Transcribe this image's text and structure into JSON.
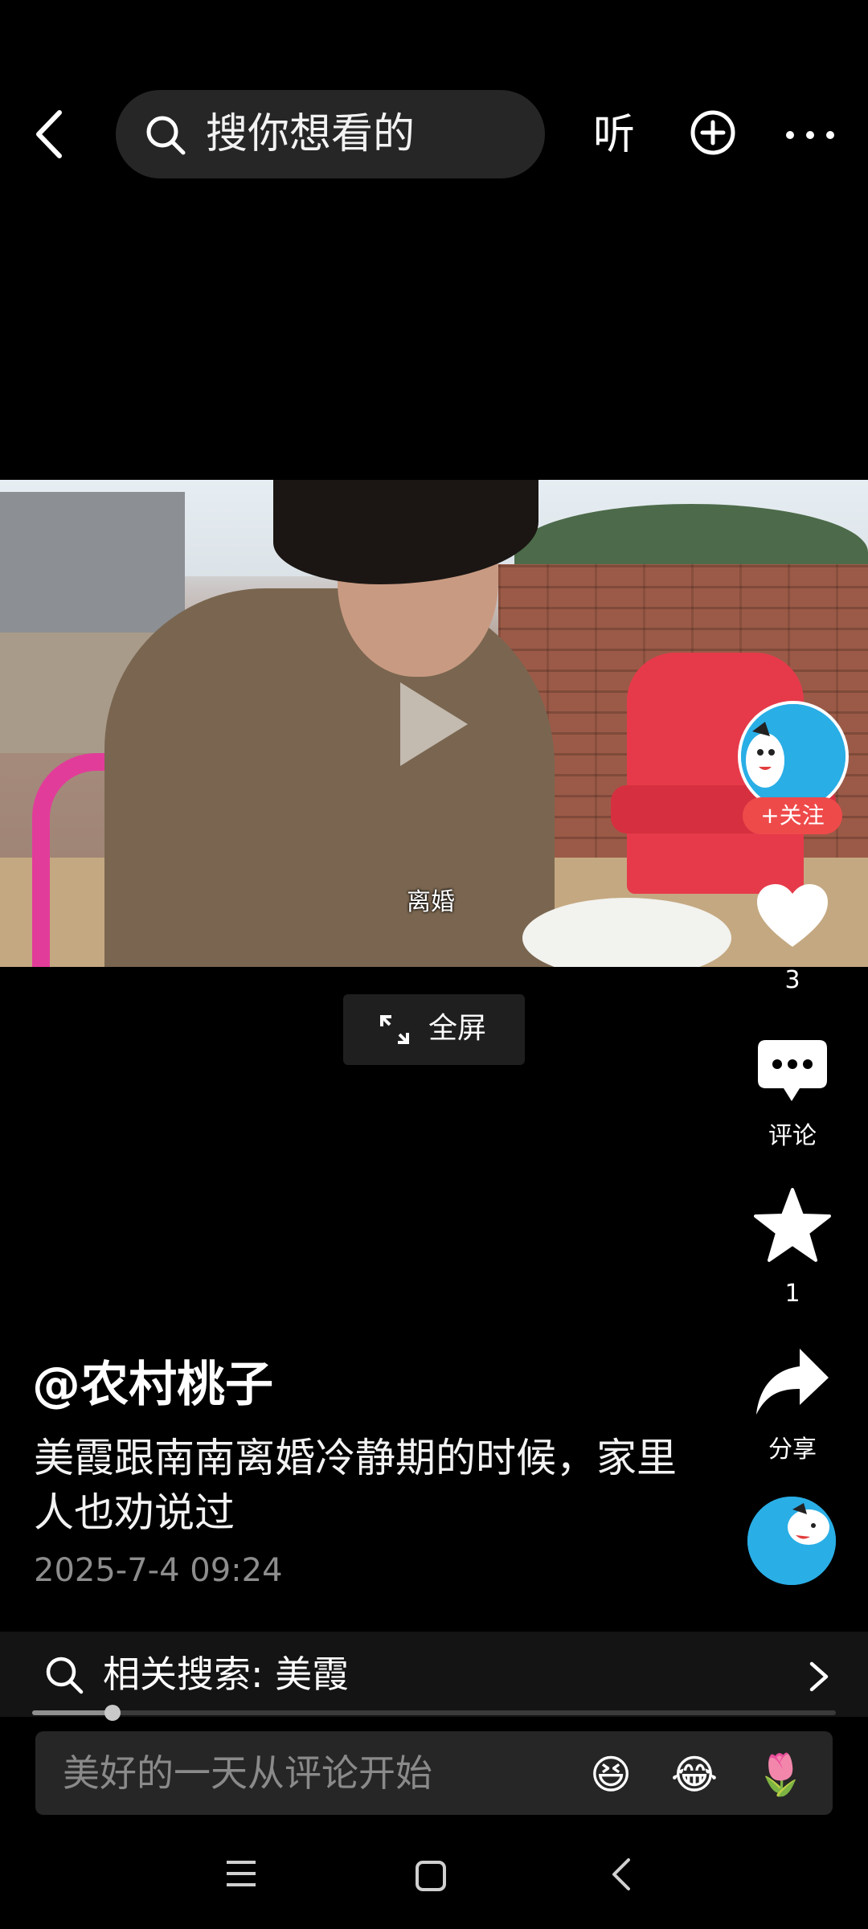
{
  "top_bar": {
    "search_placeholder": "搜你想看的",
    "listen_label": "听"
  },
  "video": {
    "caption": "离婚",
    "fullscreen_label": "全屏"
  },
  "right_rail": {
    "follow_label": "+关注",
    "like_count": "3",
    "comment_label": "评论",
    "favorite_count": "1",
    "share_label": "分享"
  },
  "post": {
    "author": "@农村桃子",
    "description": "美霞跟南南离婚冷静期的时候，家里人也劝说过",
    "timestamp": "2025-7-4 09:24"
  },
  "related_search": {
    "label": "相关搜索: 美霞"
  },
  "progress": {
    "fraction": 0.1
  },
  "comment_input": {
    "placeholder": "美好的一天从评论开始",
    "emojis": [
      "😆",
      "😂",
      "🌷"
    ]
  },
  "colors": {
    "background": "#000000",
    "follow_red": "#ef4a4a",
    "avatar_blue": "#2aaee6"
  }
}
